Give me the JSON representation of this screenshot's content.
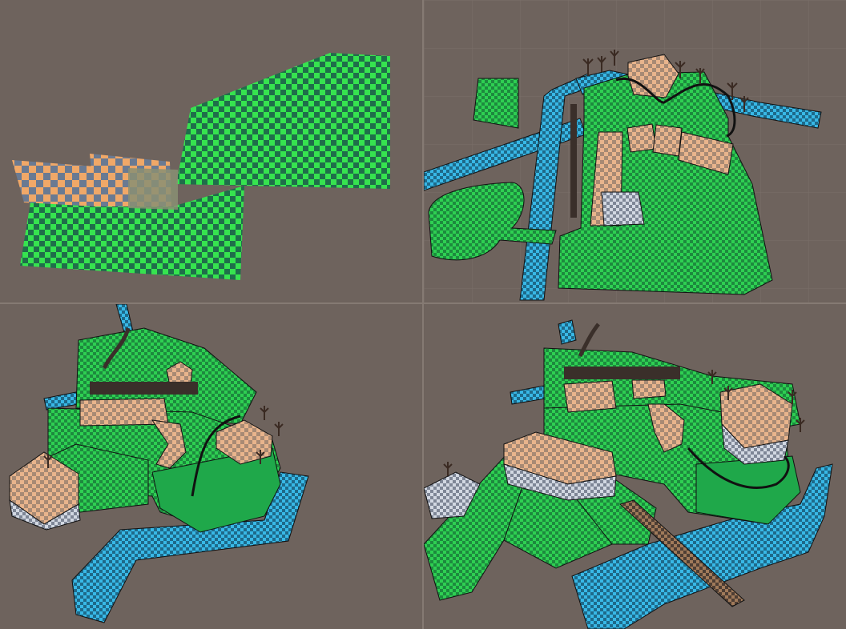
{
  "scene": {
    "background_color": "#6e635d",
    "grass_color": "#2fd04a",
    "water_color": "#2fb0dc",
    "roof_color": "#e8b48c",
    "wall_color": "#c8cfd8",
    "path_color": "#a07a5a",
    "outline_color": "#111111"
  },
  "viewports": [
    {
      "view": "top-down-flat-terrain"
    },
    {
      "view": "top-down-village"
    },
    {
      "view": "perspective-village-left"
    },
    {
      "view": "perspective-village-right"
    }
  ]
}
